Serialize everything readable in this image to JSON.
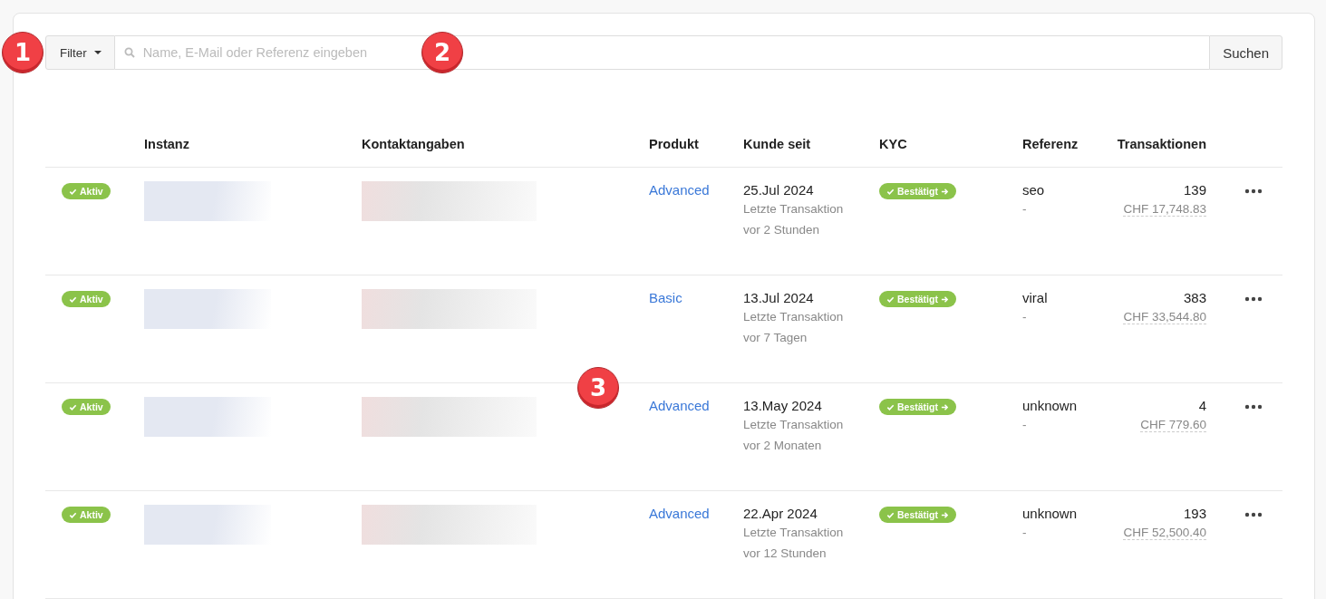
{
  "toolbar": {
    "filter_label": "Filter",
    "search": {
      "placeholder": "Name, E-Mail oder Referenz eingeben"
    },
    "search_button": "Suchen"
  },
  "markers": [
    "1",
    "2",
    "3"
  ],
  "table": {
    "columns": [
      "",
      "Instanz",
      "Kontaktangaben",
      "Produkt",
      "Kunde seit",
      "KYC",
      "Referenz",
      "Transaktionen"
    ],
    "rows": [
      {
        "status": "Aktiv",
        "product": "Advanced",
        "since": "25.Jul 2024",
        "last_transaction": "Letzte Transaktion vor 2 Stunden",
        "kyc": "Bestätigt",
        "reference": "seo",
        "reference_detail": "-",
        "transactions": "139",
        "amount": "CHF 17,748.83"
      },
      {
        "status": "Aktiv",
        "product": "Basic",
        "since": "13.Jul 2024",
        "last_transaction": "Letzte Transaktion vor 7 Tagen",
        "kyc": "Bestätigt",
        "reference": "viral",
        "reference_detail": "-",
        "transactions": "383",
        "amount": "CHF 33,544.80"
      },
      {
        "status": "Aktiv",
        "product": "Advanced",
        "since": "13.May 2024",
        "last_transaction": "Letzte Transaktion vor 2 Monaten",
        "kyc": "Bestätigt",
        "reference": "unknown",
        "reference_detail": "-",
        "transactions": "4",
        "amount": "CHF 779.60"
      },
      {
        "status": "Aktiv",
        "product": "Advanced",
        "since": "22.Apr 2024",
        "last_transaction": "Letzte Transaktion vor 12 Stunden",
        "kyc": "Bestätigt",
        "reference": "unknown",
        "reference_detail": "-",
        "transactions": "193",
        "amount": "CHF 52,500.40"
      }
    ]
  }
}
